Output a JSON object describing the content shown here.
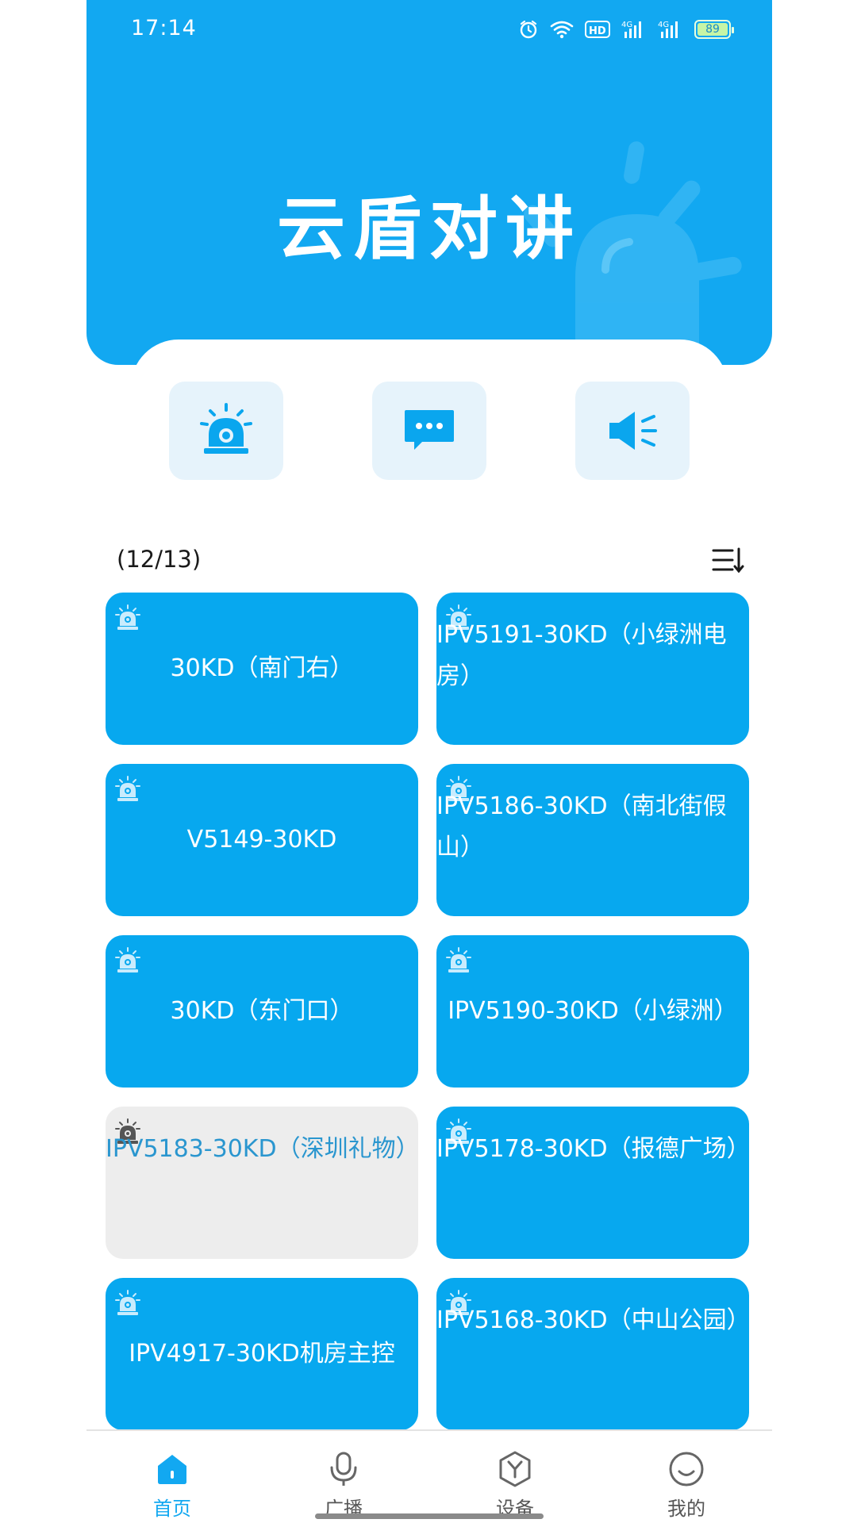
{
  "status_bar": {
    "time": "17:14",
    "battery": "89",
    "icons": [
      "alarm-icon",
      "wifi-icon",
      "hd-icon",
      "signal-4g-icon",
      "signal-4g-icon",
      "battery-icon"
    ]
  },
  "header": {
    "title": "云盾对讲",
    "background_color": "#12a8f1"
  },
  "quick_actions": [
    {
      "name": "alarm",
      "icon": "alarm-beacon-icon"
    },
    {
      "name": "message",
      "icon": "chat-bubble-icon"
    },
    {
      "name": "broadcast",
      "icon": "speaker-icon"
    }
  ],
  "device_list": {
    "count": "(12/13)",
    "sort_icon": "sort-icon",
    "devices": [
      {
        "label": "30KD（南门右）",
        "status": "online"
      },
      {
        "label": "IPV5191-30KD（小绿洲电房）",
        "status": "online"
      },
      {
        "label": "V5149-30KD",
        "status": "online"
      },
      {
        "label": "IPV5186-30KD（南北街假山）",
        "status": "online"
      },
      {
        "label": "30KD（东门口）",
        "status": "online"
      },
      {
        "label": "IPV5190-30KD（小绿洲）",
        "status": "online"
      },
      {
        "label": "IPV5183-30KD（深圳礼物）",
        "status": "offline"
      },
      {
        "label": "IPV5178-30KD（报德广场）",
        "status": "online"
      },
      {
        "label": "IPV4917-30KD机房主控",
        "status": "online"
      },
      {
        "label": "IPV5168-30KD（中山公园）",
        "status": "online"
      }
    ]
  },
  "bottom_nav": {
    "items": [
      {
        "label": "首页",
        "icon": "home-icon",
        "active": true
      },
      {
        "label": "广播",
        "icon": "microphone-icon",
        "active": false
      },
      {
        "label": "设备",
        "icon": "device-icon",
        "active": false
      },
      {
        "label": "我的",
        "icon": "profile-icon",
        "active": false
      }
    ]
  },
  "colors": {
    "accent": "#12a8f1",
    "card_online": "#07a8ef",
    "card_offline": "#ededed",
    "quick_button_bg": "#e6f3fb"
  }
}
